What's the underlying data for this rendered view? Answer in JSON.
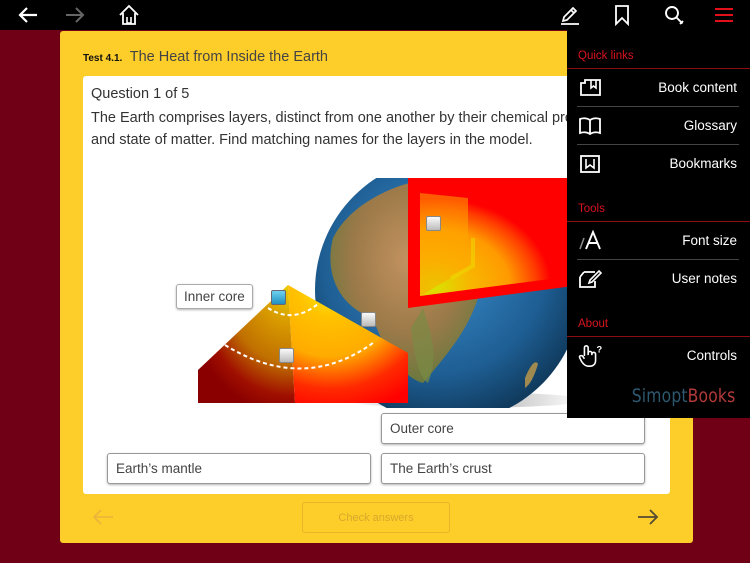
{
  "topbar": {
    "back_icon": "arrow-left-icon",
    "forward_icon": "arrow-right-icon",
    "home_icon": "home-icon",
    "notes_icon": "pencil-icon",
    "bookmark_icon": "bookmark-icon",
    "search_icon": "search-icon",
    "menu_icon": "hamburger-menu-icon",
    "menu_color": "#e3101c"
  },
  "test": {
    "number": "Test 4.1.",
    "title": "The Heat from Inside the Earth",
    "question_head": "Question 1 of 5",
    "question_text": "The Earth comprises layers, distinct from one another by their chemical properties, pressure, temperature and state of matter. Find matching names for the layers in the model.",
    "placed_label": "Inner core",
    "answers": {
      "outer_core": "Outer core",
      "mantle": "Earth’s mantle",
      "crust": "The Earth’s crust"
    },
    "check_button": "Check answers",
    "prev_icon": "arrow-left-icon",
    "next_icon": "arrow-right-icon"
  },
  "menu": {
    "sections": {
      "quick_links": "Quick links",
      "tools": "Tools",
      "about": "About"
    },
    "items": [
      {
        "label": "Book content",
        "icon": "book-content-icon"
      },
      {
        "label": "Glossary",
        "icon": "open-book-icon"
      },
      {
        "label": "Bookmarks",
        "icon": "bookmarks-icon"
      },
      {
        "label": "Font size",
        "icon": "font-size-icon"
      },
      {
        "label": "User notes",
        "icon": "user-notes-icon"
      },
      {
        "label": "Controls",
        "icon": "hand-question-icon"
      }
    ],
    "brand_part1": "Simopt",
    "brand_part2": "Books"
  },
  "colors": {
    "background": "#6f0016",
    "card": "#fdcd2a",
    "accent_red": "#d9131f"
  }
}
